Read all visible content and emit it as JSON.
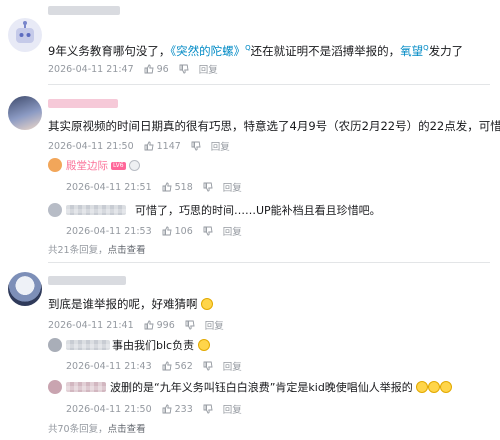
{
  "comments": [
    {
      "text_prefix": "9年义务教育哪句没了，",
      "link_text": "《突然的陀螺》",
      "link_sup": "Q",
      "text_middle": "还在就证明不是滔搏举报的，",
      "link2_text": "氧望",
      "link2_sup": "Q",
      "text_suffix": "发力了",
      "time": "2026-04-11 21:47",
      "likes": "96",
      "reply_label": "回复"
    },
    {
      "text": "其实原视频的时间日期真的很有巧思，特意选了4月9号（农历2月22号）的22点发，可惜了",
      "time": "2026-04-11 21:50",
      "likes": "1147",
      "reply_label": "回复",
      "replies": [
        {
          "username": "殿堂边际",
          "badge": "LV6",
          "time": "2026-04-11 21:51",
          "likes": "518",
          "reply_label": "回复"
        },
        {
          "text": "可惜了，巧思的时间……UP能补档且看且珍惜吧。",
          "time": "2026-04-11 21:53",
          "likes": "106",
          "reply_label": "回复"
        }
      ],
      "more_text": "共21条回复，",
      "more_click": "点击查看"
    },
    {
      "text": "到底是谁举报的呢，好难猜啊",
      "time": "2026-04-11 21:41",
      "likes": "996",
      "reply_label": "回复",
      "replies": [
        {
          "text": "事由我们blc负责",
          "time": "2026-04-11 21:43",
          "likes": "562",
          "reply_label": "回复"
        },
        {
          "text": "波删的是“九年义务叫钰白白浪费”肯定是kid晚使唱仙人举报的",
          "time": "2026-04-11 21:50",
          "likes": "233",
          "reply_label": "回复"
        }
      ],
      "more_text": "共70条回复，",
      "more_click": "点击查看"
    }
  ],
  "colors": {
    "link": "#008ac5",
    "meta": "#9499a0",
    "vip_name": "#fb7299",
    "divider": "#e3e5e7"
  },
  "icons": [
    "like-icon",
    "dislike-icon",
    "robot-avatar-icon",
    "emoji-icon"
  ]
}
